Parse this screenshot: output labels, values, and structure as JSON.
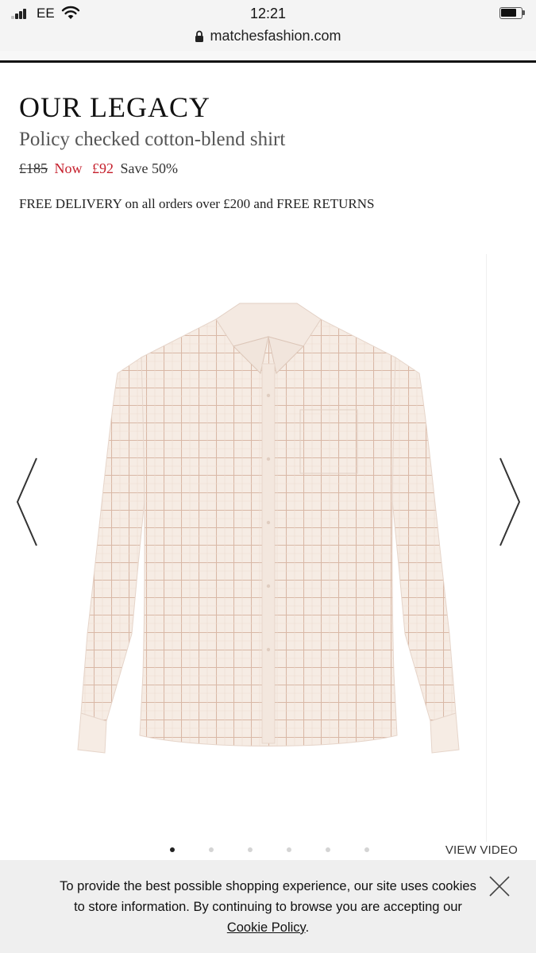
{
  "status_bar": {
    "carrier": "EE",
    "time": "12:21"
  },
  "browser": {
    "url": "matchesfashion.com"
  },
  "product": {
    "brand": "OUR LEGACY",
    "name": "Policy checked cotton-blend shirt",
    "price_original": "£185",
    "price_now_label": "Now",
    "price_now": "£92",
    "savings": "Save 50%",
    "delivery_note": "FREE DELIVERY on all orders over £200 and FREE RETURNS"
  },
  "gallery": {
    "image_count": 6,
    "active_index": 0,
    "view_video_label": "VIEW VIDEO"
  },
  "cookie_banner": {
    "text_before": "To provide the best possible shopping experience, our site uses cookies to store information. By continuing to browse you are accepting our ",
    "link_label": "Cookie Policy",
    "text_after": "."
  },
  "colors": {
    "sale_red": "#c51e2b",
    "banner_bg": "#efefef"
  },
  "icons": {
    "status": [
      "signal-icon",
      "wifi-icon",
      "battery-icon"
    ],
    "browser": [
      "lock-icon"
    ],
    "gallery": [
      "chevron-left-icon",
      "chevron-right-icon"
    ],
    "banner": [
      "close-icon"
    ]
  }
}
